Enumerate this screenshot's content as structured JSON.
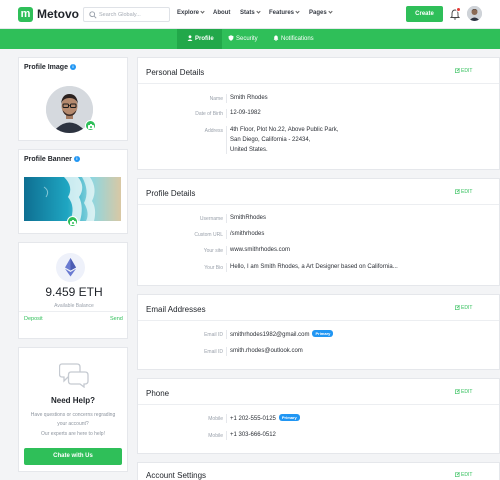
{
  "brand": {
    "logo_letter": "m",
    "name": "Metovo",
    "accent": "#2fbf59"
  },
  "search": {
    "placeholder": "Search Globaly..."
  },
  "nav": {
    "explore": "Explore",
    "about": "About",
    "stats": "Stats",
    "features": "Features",
    "pages": "Pages"
  },
  "header": {
    "create_label": "Create"
  },
  "tabs": {
    "profile": "Profile",
    "security": "Security",
    "notifications": "Notifications"
  },
  "profile_image": {
    "title": "Profile Image"
  },
  "profile_banner": {
    "title": "Profile Banner"
  },
  "wallet": {
    "amount": "9.459 ETH",
    "caption": "Available Balance",
    "deposit": "Deposit",
    "send": "Send"
  },
  "help": {
    "title": "Need Help?",
    "line1": "Have questions or concerns regrading",
    "line2": "your account?",
    "line3": "Our experts are here to help!",
    "button": "Chate with Us"
  },
  "edit_label": "EDIT",
  "personal": {
    "title": "Personal Details",
    "name_label": "Name",
    "name": "Smith Rhodes",
    "birth_label": "Date of Birth",
    "birth": "12-09-1982",
    "address_label": "Address",
    "address_line1": "4th Floor, Plot No.22, Above Public Park,",
    "address_line2": "San Diego, California - 22434,",
    "address_line3": "United States."
  },
  "profile_details": {
    "title": "Profile Details",
    "username_label": "Username",
    "username": "SmithRhodes",
    "url_label": "Custom URL",
    "url": "/smithrhodes",
    "site_label": "Your site",
    "site": "www.smithrhodes.com",
    "bio_label": "Your Bio",
    "bio": "Hello, I am Smith Rhodes, a Art Designer based on California..."
  },
  "emails": {
    "title": "Email Addresses",
    "label": "Email ID",
    "primary": "smithrhodes1982@gmail.com",
    "secondary": "smith.rhodes@outlook.com",
    "primary_badge": "Primary"
  },
  "phone": {
    "title": "Phone",
    "label": "Mobile",
    "primary": "+1 202-555-0125",
    "secondary": "+1 303-666-0512",
    "primary_badge": "Primary"
  },
  "account_settings": {
    "title": "Account Settings"
  }
}
